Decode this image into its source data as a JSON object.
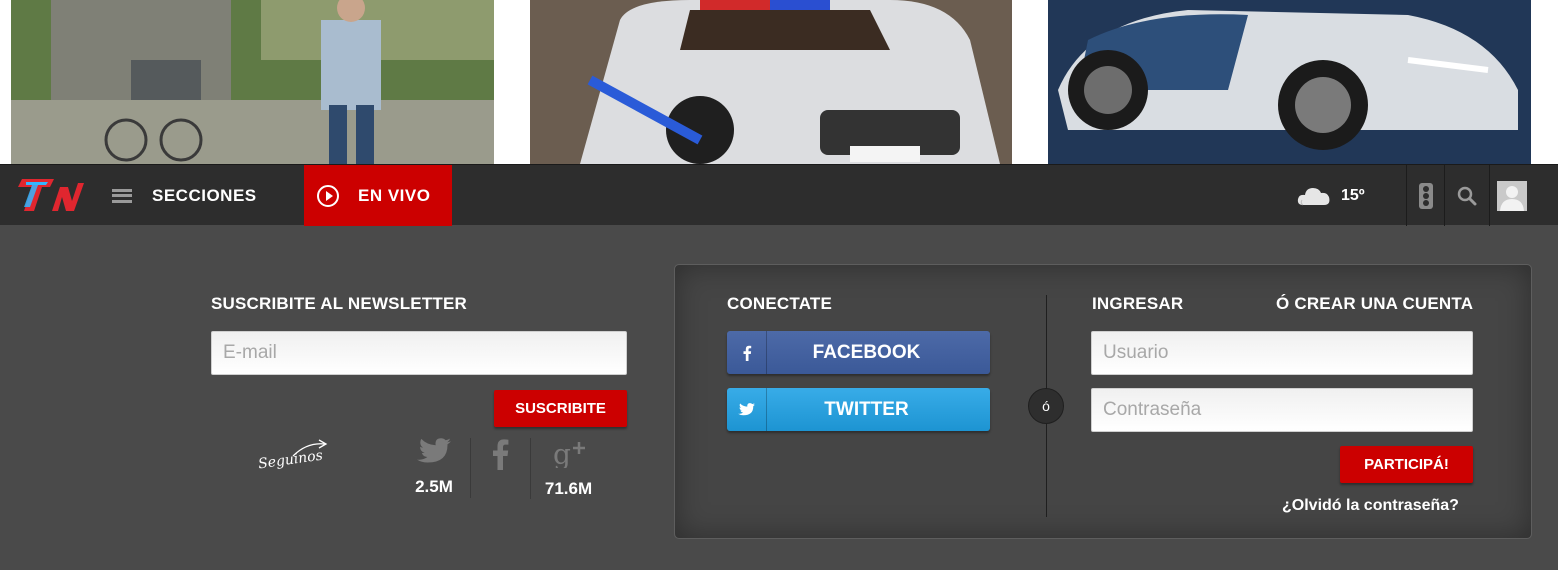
{
  "colors": {
    "accent": "#cc0000",
    "navbar": "#2d2d2d",
    "footer_bg": "#4a4a4a",
    "facebook": "#3b5998",
    "twitter": "#1d94d2"
  },
  "photos": [
    {
      "name": "news-photo-man-with-stroller"
    },
    {
      "name": "news-photo-police-car"
    },
    {
      "name": "news-photo-concept-car"
    }
  ],
  "navbar": {
    "logo_icon": "tn-logo",
    "menu_icon": "hamburger-icon",
    "sections_label": "SECCIONES",
    "live_icon": "play-circle-icon",
    "live_label": "EN VIVO",
    "weather_icon": "cloud-icon",
    "temperature": "15º",
    "traffic_icon": "traffic-light-icon",
    "search_icon": "search-icon",
    "user_icon": "user-avatar-icon"
  },
  "newsletter": {
    "title": "SUSCRIBITE AL NEWSLETTER",
    "email_placeholder": "E-mail",
    "subscribe_label": "SUSCRIBITE",
    "follow_text": "Seguinos",
    "twitter_count": "2.5M",
    "googleplus_count": "71.6M"
  },
  "login": {
    "connect_title": "CONECTATE",
    "facebook_label": "FACEBOOK",
    "twitter_label": "TWITTER",
    "or_text": "ó",
    "login_title": "INGRESAR",
    "create_title": "Ó CREAR UNA CUENTA",
    "username_placeholder": "Usuario",
    "password_placeholder": "Contraseña",
    "submit_label": "PARTICIPÁ!",
    "forgot_label": "¿Olvidó la contraseña?"
  }
}
